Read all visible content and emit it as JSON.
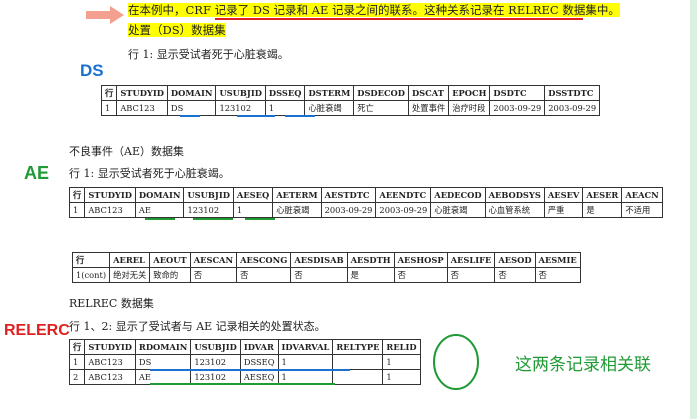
{
  "intro": {
    "line1": "在本例中，CRF 记录了 DS 记录和 AE 记录之间的联系。这种关系记录在 RELREC 数据集中。",
    "line2": "处置（DS）数据集"
  },
  "ds": {
    "tag": "DS",
    "caption": "行 1:  显示受试者死于心脏衰竭。",
    "headers": [
      "行",
      "STUDYID",
      "DOMAIN",
      "USUBJID",
      "DSSEQ",
      "DSTERM",
      "DSDECOD",
      "DSCAT",
      "EPOCH",
      "DSDTC",
      "DSSTDTC"
    ],
    "rows": [
      [
        "1",
        "ABC123",
        "DS",
        "123102",
        "1",
        "心脏衰竭",
        "死亡",
        "处置事件",
        "治疗时段",
        "2003-09-29",
        "2003-09-29"
      ]
    ]
  },
  "ae": {
    "heading": "不良事件（AE）数据集",
    "tag": "AE",
    "caption": "行 1: 显示受试者死于心脏衰竭。",
    "headers": [
      "行",
      "STUDYID",
      "DOMAIN",
      "USUBJID",
      "AESEQ",
      "AETERM",
      "AESTDTC",
      "AEENDTC",
      "AEDECOD",
      "AEBODSYS",
      "AESEV",
      "AESER",
      "AEACN"
    ],
    "rows": [
      [
        "1",
        "ABC123",
        "AE",
        "123102",
        "1",
        "心脏衰竭",
        "2003-09-29",
        "2003-09-29",
        "心脏衰竭",
        "心血管系统",
        "严重",
        "是",
        "不适用"
      ]
    ],
    "headers2": [
      "行",
      "AEREL",
      "AEOUT",
      "AESCAN",
      "AESCONG",
      "AESDISAB",
      "AESDTH",
      "AESHOSP",
      "AESLIFE",
      "AESOD",
      "AESMIE"
    ],
    "rows2": [
      [
        "1(cont)",
        "绝对无关",
        "致命的",
        "否",
        "否",
        "否",
        "是",
        "否",
        "否",
        "否",
        "否"
      ]
    ]
  },
  "relrec": {
    "heading": "RELREC 数据集",
    "tag": "RELERC",
    "caption": "行 1、2:  显示了受试者与 AE 记录相关的处置状态。",
    "headers": [
      "行",
      "STUDYID",
      "RDOMAIN",
      "USUBJID",
      "IDVAR",
      "IDVARVAL",
      "RELTYPE",
      "RELID"
    ],
    "rows": [
      [
        "1",
        "ABC123",
        "DS",
        "123102",
        "DSSEQ",
        "1",
        "",
        "1"
      ],
      [
        "2",
        "ABC123",
        "AE",
        "123102",
        "AESEQ",
        "1",
        "",
        "1"
      ]
    ],
    "note": "这两条记录相关联"
  },
  "colors": {
    "highlight": "#ffff00",
    "arrow": "#f4a090",
    "red": "#e02020",
    "blue": "#1a72d0",
    "green": "#1f9a34"
  }
}
